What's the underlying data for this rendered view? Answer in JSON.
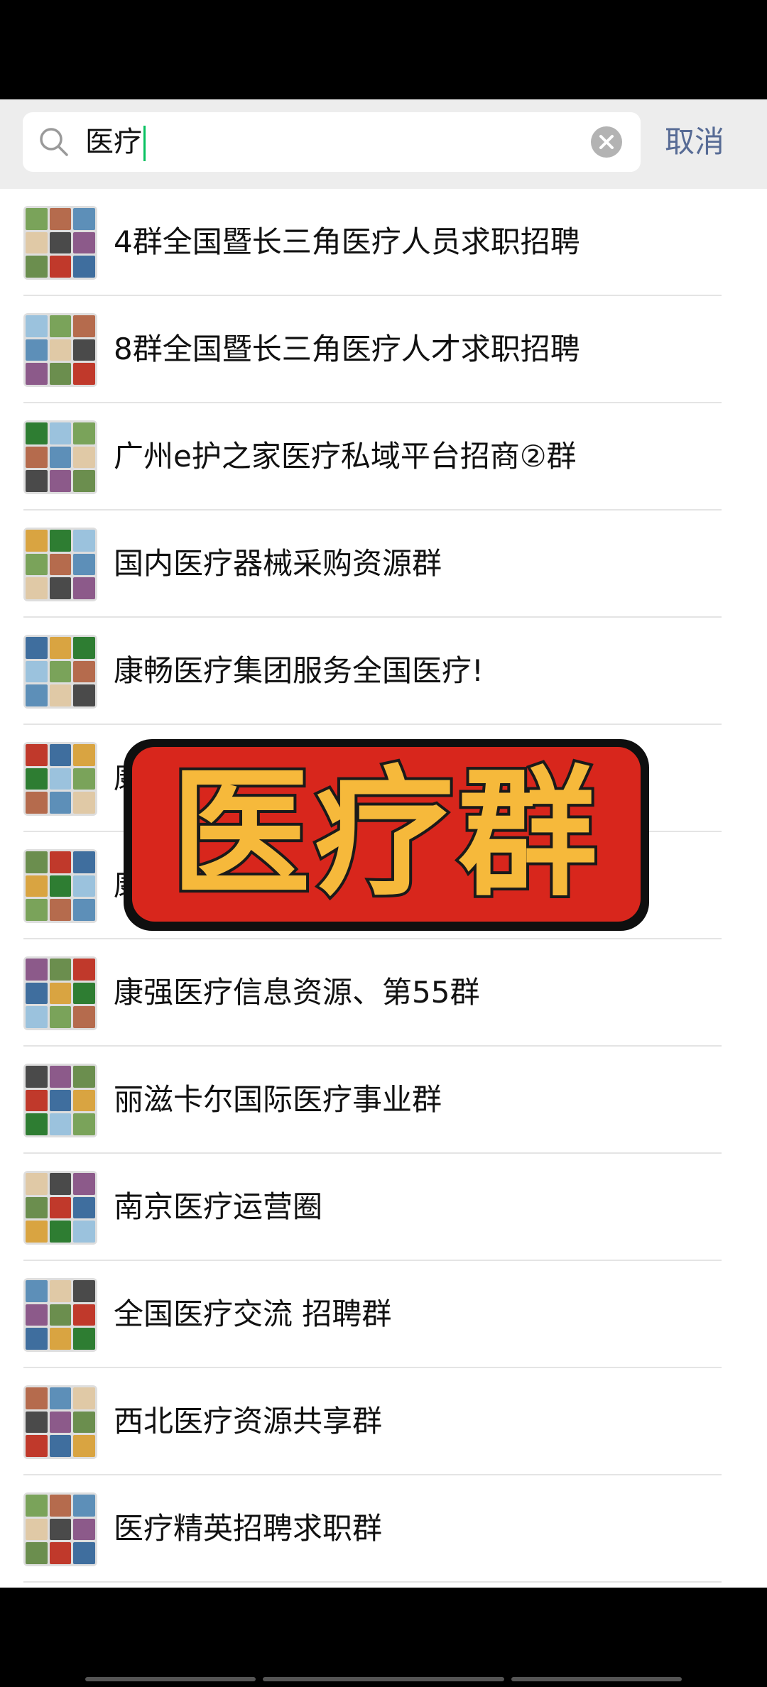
{
  "search": {
    "query": "医疗",
    "cancel_label": "取消"
  },
  "results": [
    {
      "title": "4群全国暨长三角医疗人员求职招聘"
    },
    {
      "title": "8群全国暨长三角医疗人才求职招聘"
    },
    {
      "title": "广州e护之家医疗私域平台招商②群"
    },
    {
      "title": "国内医疗器械采购资源群"
    },
    {
      "title": "康畅医疗集团服务全国医疗!"
    },
    {
      "title": "康"
    },
    {
      "title": "康                              55"
    },
    {
      "title": "康强医疗信息资源、第55群"
    },
    {
      "title": "丽滋卡尔国际医疗事业群"
    },
    {
      "title": "南京医疗运营圈"
    },
    {
      "title": "全国医疗交流  招聘群"
    },
    {
      "title": "西北医疗资源共享群"
    },
    {
      "title": "医疗精英招聘求职群"
    }
  ],
  "overlay": {
    "text": "医疗群"
  },
  "colors": {
    "accent_link": "#576b95",
    "caret": "#07c160",
    "overlay_bg": "#d8261c",
    "overlay_text": "#f6b93b"
  }
}
